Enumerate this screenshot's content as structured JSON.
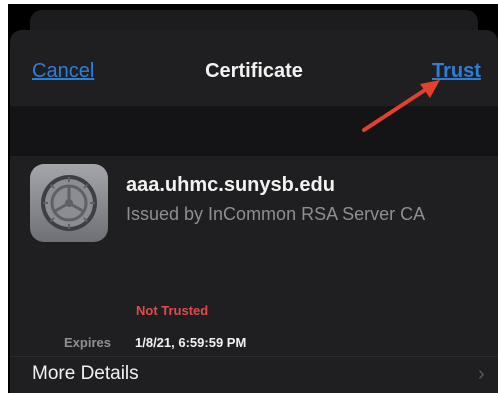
{
  "nav": {
    "cancel_label": "Cancel",
    "title": "Certificate",
    "trust_label": "Trust"
  },
  "certificate": {
    "name": "aaa.uhmc.sunysb.edu",
    "issuer": "Issued by InCommon RSA Server CA",
    "status": "Not Trusted",
    "expires_label": "Expires",
    "expires_value": "1/8/21, 6:59:59 PM"
  },
  "more_details": {
    "label": "More Details"
  },
  "icons": {
    "certificate": "gear-icon",
    "chevron": "chevron-right-icon",
    "annotation": "red-arrow-icon"
  },
  "colors": {
    "link": "#2d7fd6",
    "status_red": "#e14b4b",
    "arrow_red": "#e2412e",
    "sheet_bg": "#1f1f21"
  }
}
